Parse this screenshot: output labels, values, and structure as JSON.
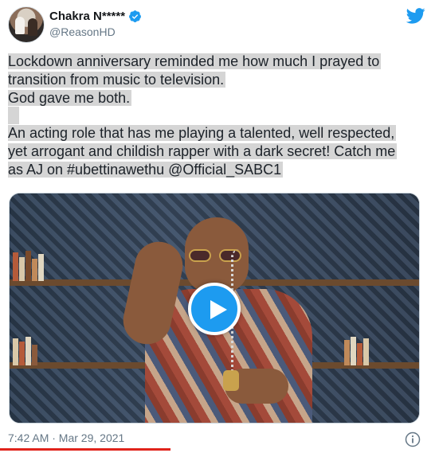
{
  "author": {
    "display_name": "Chakra N*****",
    "handle": "@ReasonHD",
    "verified": true
  },
  "tweet": {
    "paragraph1": [
      "Lockdown anniversary reminded me how much I prayed to",
      "transition from music to television.",
      "God gave me both."
    ],
    "paragraph2": [
      "An acting role that has me playing a talented, well respected,",
      "yet arrogant and childish rapper with a dark secret! Catch me",
      "as AJ on #ubettinawethu @Official_SABC1"
    ],
    "timestamp": "7:42 AM · Mar 29, 2021"
  },
  "icons": {
    "brand": "twitter-bird-icon",
    "verified": "verified-badge-icon",
    "play": "play-icon",
    "info": "info-icon"
  },
  "colors": {
    "brand_blue": "#1d9bf0",
    "highlight": "#d5d5d5",
    "secondary_text": "#657786",
    "underline_mark": "#e0231b"
  }
}
